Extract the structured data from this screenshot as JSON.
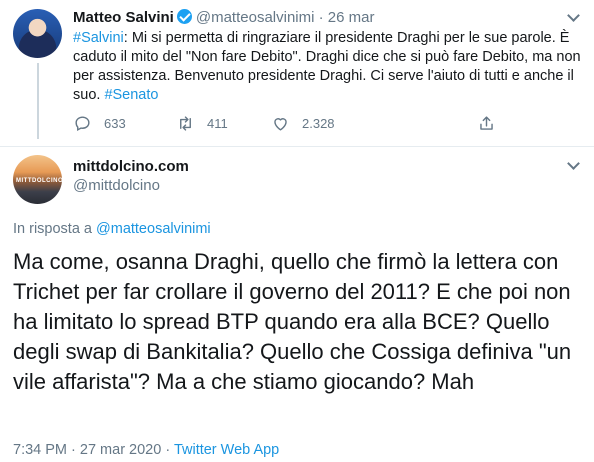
{
  "parent_tweet": {
    "display_name": "Matteo Salvini",
    "handle": "@matteosalvinimi",
    "separator": "·",
    "date": "26 mar",
    "hashtag_start": "#Salvini",
    "text": ": Mi si permetta di ringraziare il presidente Draghi per le sue parole. È caduto il mito del \"Non fare Debito\". Draghi dice che si può fare Debito, ma non per assistenza. Benvenuto presidente Draghi. Ci serve l'aiuto di tutti e anche il suo. ",
    "hashtag_end": "#Senato",
    "replies": "633",
    "retweets": "411",
    "likes": "2.328"
  },
  "reply_tweet": {
    "display_name": "mittdolcino.com",
    "handle": "@mittdolcino",
    "avatar_text": "MITTDOLCINO",
    "reply_prefix": "In risposta a ",
    "reply_handle": "@matteosalvinimi",
    "text": "Ma come, osanna Draghi, quello che firmò la lettera con Trichet per far crollare il governo del 2011? E che poi non ha limitato lo spread BTP quando era alla BCE? Quello degli swap di Bankitalia? Quello che Cossiga definiva \"un vile affarista\"? Ma a che stiamo giocando? Mah",
    "time": "7:34 PM",
    "separator": " · ",
    "date": "27 mar 2020",
    "source": "Twitter Web App"
  },
  "colors": {
    "link": "#1b95e0",
    "muted": "#657786",
    "verified": "#1da1f2"
  }
}
